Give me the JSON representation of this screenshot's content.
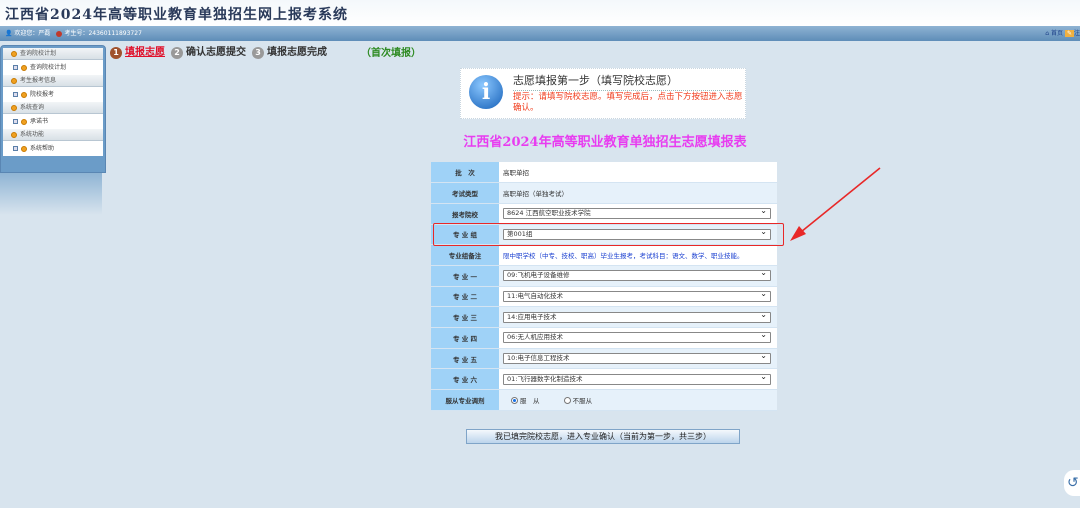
{
  "header": {
    "title": "江西省2024年高等职业教育单独招生网上报考系统"
  },
  "topbar": {
    "welcome": "欢迎您：严磊",
    "exam_no": "考生号：24360111893727",
    "home": "首页",
    "cut": "注"
  },
  "sidebar": [
    {
      "group": "查询院校计划",
      "items": [
        "查询院校计划"
      ]
    },
    {
      "group": "考生报考信息",
      "items": [
        "院校报考"
      ]
    },
    {
      "group": "系统查询",
      "items": [
        "承诺书"
      ]
    },
    {
      "group": "系统功能",
      "items": [
        "系统帮助"
      ]
    }
  ],
  "steps": [
    {
      "num": "1",
      "label": "填报志愿"
    },
    {
      "num": "2",
      "label": "确认志愿提交"
    },
    {
      "num": "3",
      "label": "填报志愿完成"
    }
  ],
  "status": "（首次填报）",
  "info": {
    "title": "志愿填报第一步（填写院校志愿）",
    "tip": "提示：请填写院校志愿。填写完成后，点击下方按钮进入志愿确认。"
  },
  "form": {
    "title": "江西省2024年高等职业教育单独招生志愿填报表",
    "batch": {
      "label": "批　次",
      "value": "高职单招"
    },
    "exam_type": {
      "label": "考试类型",
      "value": "高职单招（单独考试）"
    },
    "school": {
      "label": "报考院校",
      "value": "8624 江西航空职业技术学院"
    },
    "group": {
      "label": "专 业 组",
      "value": "第001组"
    },
    "group_note": {
      "label": "专业组备注",
      "value": "限中职学校（中专、技校、职高）毕业生报考，考试科目：语文、数学、职业技能。"
    },
    "majors": [
      {
        "label": "专 业 一",
        "value": "09:飞机电子设备维修"
      },
      {
        "label": "专 业 二",
        "value": "11:电气自动化技术"
      },
      {
        "label": "专 业 三",
        "value": "14:应用电子技术"
      },
      {
        "label": "专 业 四",
        "value": "06:无人机应用技术"
      },
      {
        "label": "专 业 五",
        "value": "10:电子信息工程技术"
      },
      {
        "label": "专 业 六",
        "value": "01:飞行器数字化制造技术"
      }
    ],
    "adjust": {
      "label": "服从专业调剂",
      "yes": "服　从",
      "no": "不服从",
      "selected": "服从"
    }
  },
  "submit_label": "我已填完院校志愿，进入专业确认（当前为第一步，共三步）",
  "colors": {
    "highlight": "#e82828",
    "title": "#e83cf0",
    "tip": "#f03c1c"
  }
}
